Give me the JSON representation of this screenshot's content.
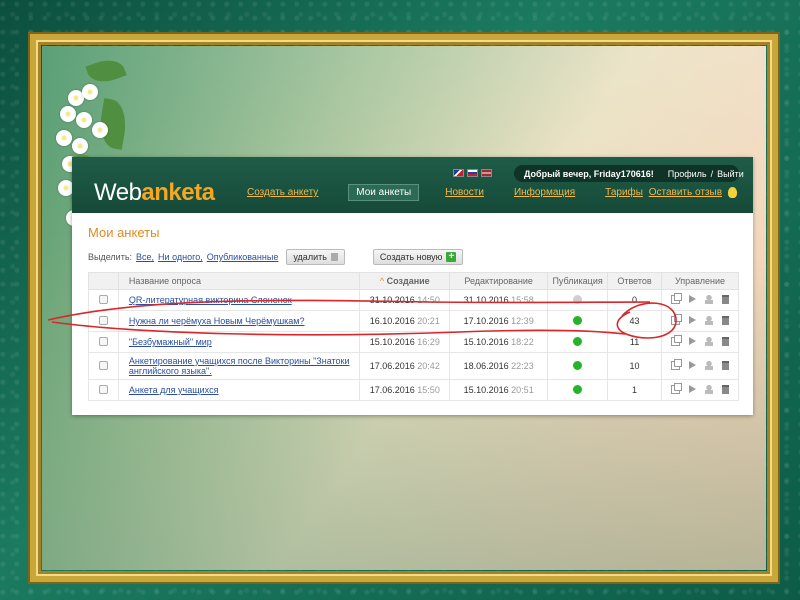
{
  "header": {
    "logo_prefix": "Web",
    "logo_suffix": "anketa",
    "greeting": "Добрый вечер, Friday170616!",
    "profile_link": "Профиль",
    "separator": "/",
    "logout_link": "Выйти",
    "nav": [
      {
        "label": "Создать анкету"
      },
      {
        "label": "Мои анкеты"
      },
      {
        "label": "Новости"
      },
      {
        "label": "Информация"
      },
      {
        "label": "Тарифы"
      }
    ],
    "feedback_link": "Оставить отзыв"
  },
  "page": {
    "title": "Мои анкеты",
    "select_label": "Выделить:",
    "select_all": "Все,",
    "select_none": "Ни одного,",
    "select_published": "Опубликованные",
    "delete_button": "удалить",
    "new_button": "Создать новую"
  },
  "table": {
    "headers": {
      "name": "Название опроса",
      "sort_arrow": "^",
      "created": "Создание",
      "edited": "Редактирование",
      "published": "Публикация",
      "answers": "Ответов",
      "manage": "Управление"
    },
    "rows": [
      {
        "name": "QR-литературная викторина Слоненок",
        "created_date": "31.10.2016",
        "created_time": "14:50",
        "edited_date": "31.10.2016",
        "edited_time": "15:58",
        "published": false,
        "answers": "0"
      },
      {
        "name": "Нужна ли черёмуха Новым Черёмушкам?",
        "created_date": "16.10.2016",
        "created_time": "20:21",
        "edited_date": "17.10.2016",
        "edited_time": "12:39",
        "published": true,
        "answers": "43"
      },
      {
        "name": "\"Безбумажный\" мир",
        "created_date": "15.10.2016",
        "created_time": "16:29",
        "edited_date": "15.10.2016",
        "edited_time": "18:22",
        "published": true,
        "answers": "11"
      },
      {
        "name": "Анкетирование учащихся после Викторины \"Знатоки английского языка\".",
        "created_date": "17.06.2016",
        "created_time": "20:42",
        "edited_date": "18.06.2016",
        "edited_time": "22:23",
        "published": true,
        "answers": "10"
      },
      {
        "name": "Анкета для учащихся",
        "created_date": "17.06.2016",
        "created_time": "15:50",
        "edited_date": "15.10.2016",
        "edited_time": "20:51",
        "published": true,
        "answers": "1"
      }
    ]
  },
  "colors": {
    "header_bg": "#1f5c48",
    "accent_orange": "#e08a1e",
    "link_blue": "#2a4fa0",
    "published_green": "#26b32a",
    "annotation_red": "#d8282b"
  }
}
